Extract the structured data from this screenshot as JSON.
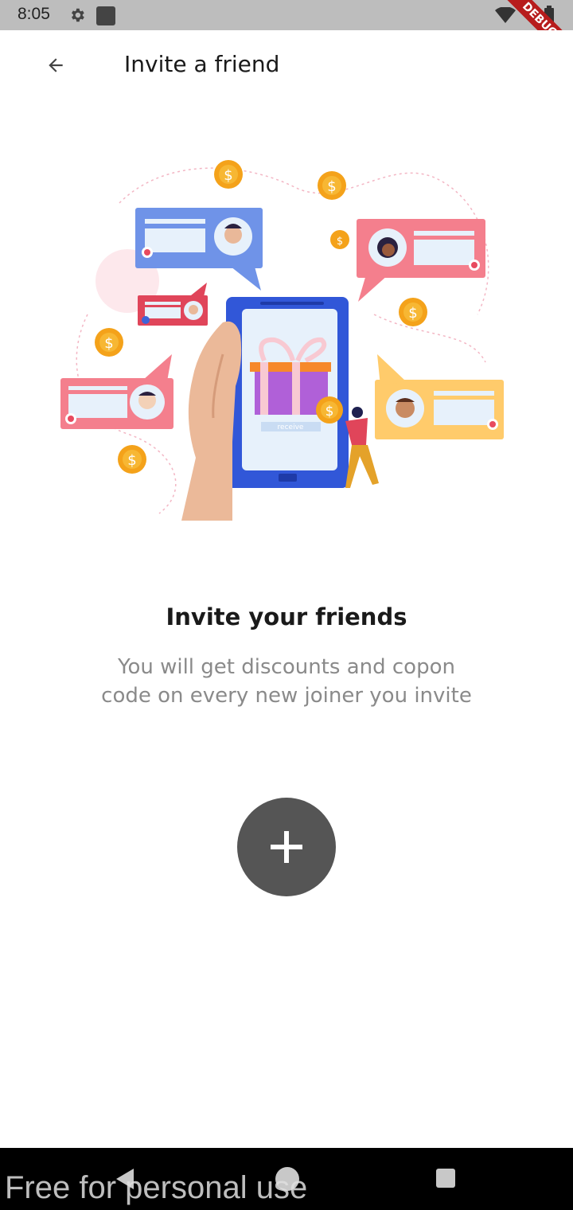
{
  "status_bar": {
    "time": "8:05",
    "icons": [
      "gear-icon",
      "app-square-icon",
      "wifi-icon",
      "battery-icon"
    ]
  },
  "debug_banner": "DEBUG",
  "app_bar": {
    "back_icon": "arrow-back-icon",
    "title": "Invite a friend"
  },
  "illustration": {
    "description_icons": [
      "coin-icon",
      "chat-bubble-icon",
      "phone-icon",
      "gift-icon",
      "hand-icon",
      "person-icon"
    ],
    "gift_button_label": "receive"
  },
  "content": {
    "heading": "Invite your friends",
    "subtext_line1": "You will get discounts and copon",
    "subtext_line2": "code on every new joiner you invite"
  },
  "add_button": {
    "icon": "plus-icon"
  },
  "nav_bar": {
    "icons": [
      "nav-back-icon",
      "nav-home-icon",
      "nav-recents-icon"
    ]
  },
  "watermark": "Free for personal use",
  "colors": {
    "status_bar": "#bdbdbd",
    "add_button": "#555555",
    "heading": "#1a1a1a",
    "subtext": "#8a8a8a",
    "nav_bar": "#000000",
    "debug_ribbon": "#b71c1c"
  }
}
